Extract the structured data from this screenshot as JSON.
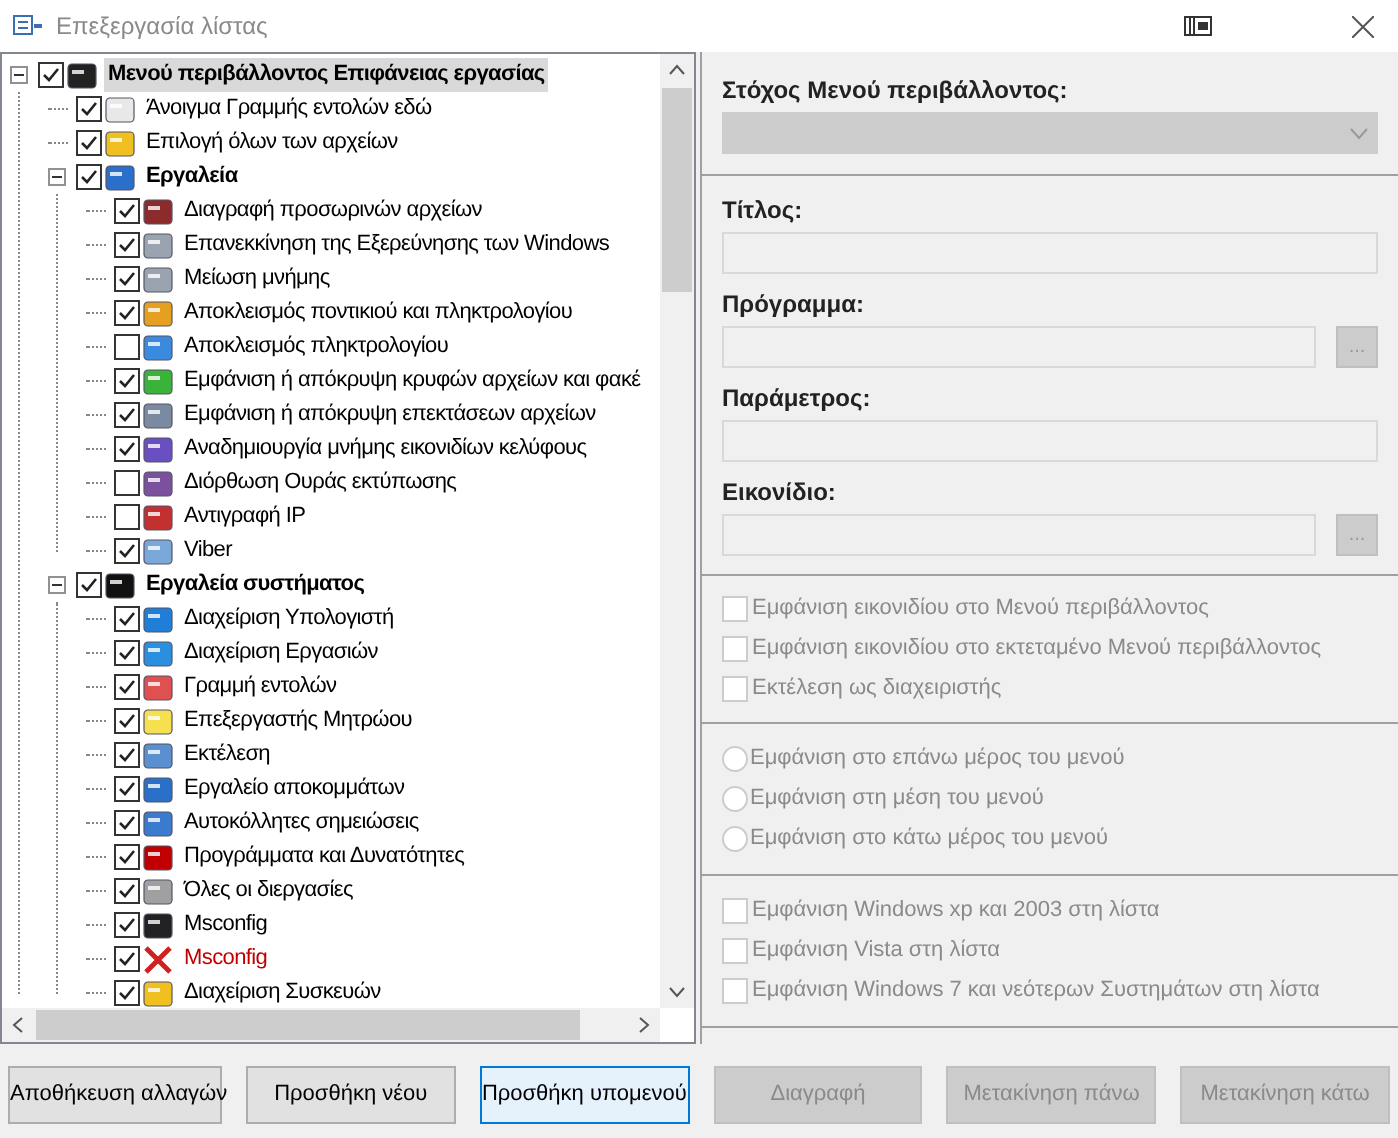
{
  "window": {
    "title": "Επεξεργασία λίστας"
  },
  "tree": [
    {
      "label": "Μενού περιβάλλοντος Επιφάνειας εργασίας",
      "checked": true,
      "expanded": true,
      "selected": true,
      "children": [
        {
          "label": "Άνοιγμα Γραμμής εντολών εδώ",
          "checked": true,
          "invalid": false
        },
        {
          "label": "Επιλογή όλων των αρχείων",
          "checked": true,
          "invalid": false
        },
        {
          "label": "Εργαλεία",
          "checked": true,
          "expanded": true,
          "selected": false,
          "children": [
            {
              "label": "Διαγραφή προσωρινών αρχείων",
              "checked": true,
              "invalid": false
            },
            {
              "label": "Επανεκκίνηση της Εξερεύνησης των Windows",
              "checked": true,
              "invalid": false
            },
            {
              "label": "Μείωση μνήμης",
              "checked": true,
              "invalid": false
            },
            {
              "label": "Αποκλεισμός ποντικιού και πληκτρολογίου",
              "checked": true,
              "invalid": false
            },
            {
              "label": "Αποκλεισμός πληκτρολογίου",
              "checked": false,
              "invalid": false
            },
            {
              "label": "Εμφάνιση ή απόκρυψη κρυφών αρχείων και φακέ",
              "checked": true,
              "invalid": false
            },
            {
              "label": "Εμφάνιση ή απόκρυψη επεκτάσεων αρχείων",
              "checked": true,
              "invalid": false
            },
            {
              "label": "Αναδημιουργία μνήμης εικονιδίων κελύφους",
              "checked": true,
              "invalid": false
            },
            {
              "label": "Διόρθωση Ουράς εκτύπωσης",
              "checked": false,
              "invalid": false
            },
            {
              "label": "Αντιγραφή IP",
              "checked": false,
              "invalid": false
            },
            {
              "label": "Viber",
              "checked": true,
              "invalid": false
            }
          ]
        },
        {
          "label": "Εργαλεία συστήματος",
          "checked": true,
          "expanded": true,
          "selected": false,
          "children": [
            {
              "label": "Διαχείριση Υπολογιστή",
              "checked": true,
              "invalid": false
            },
            {
              "label": "Διαχείριση Εργασιών",
              "checked": true,
              "invalid": false
            },
            {
              "label": "Γραμμή εντολών",
              "checked": true,
              "invalid": false
            },
            {
              "label": "Επεξεργαστής Μητρώου",
              "checked": true,
              "invalid": false
            },
            {
              "label": "Εκτέλεση",
              "checked": true,
              "invalid": false
            },
            {
              "label": "Εργαλείο αποκομμάτων",
              "checked": true,
              "invalid": false
            },
            {
              "label": "Αυτοκόλλητες σημειώσεις",
              "checked": true,
              "invalid": false
            },
            {
              "label": "Προγράμματα και Δυνατότητες",
              "checked": true,
              "invalid": false
            },
            {
              "label": "Όλες οι διεργασίες",
              "checked": true,
              "invalid": false
            },
            {
              "label": "Msconfig",
              "checked": true,
              "invalid": false
            },
            {
              "label": "Msconfig",
              "checked": true,
              "invalid": true
            },
            {
              "label": "Διαχείριση Συσκευών",
              "checked": true,
              "invalid": false
            }
          ]
        }
      ]
    }
  ],
  "target": {
    "label": "Στόχος Μενού περιβάλλοντος:",
    "disabled": true
  },
  "fields": [
    {
      "label": "Τίτλος:",
      "browse": false
    },
    {
      "label": "Πρόγραμμα:",
      "browse": true,
      "browse_label": "..."
    },
    {
      "label": "Παράμετρος:",
      "browse": false
    },
    {
      "label": "Εικονίδιο:",
      "browse": true,
      "browse_label": "..."
    }
  ],
  "options": [
    {
      "label": "Εμφάνιση εικονιδίου στο Μενού περιβάλλοντος",
      "checked": false
    },
    {
      "label": "Εμφάνιση εικονιδίου στο εκτεταμένο Μενού περιβάλλοντος",
      "checked": false
    },
    {
      "label": "Εκτέλεση ως διαχειριστής",
      "checked": false
    }
  ],
  "position": [
    {
      "label": "Εμφάνιση στο επάνω μέρος του μενού",
      "selected": false
    },
    {
      "label": "Εμφάνιση στη μέση του μενού",
      "selected": false
    },
    {
      "label": "Εμφάνιση στο κάτω μέρος του μενού",
      "selected": false
    }
  ],
  "systems": [
    {
      "label": "Εμφάνιση Windows xp και 2003 στη λίστα",
      "checked": false
    },
    {
      "label": "Εμφάνιση Vista στη λίστα",
      "checked": false
    },
    {
      "label": "Εμφάνιση Windows 7 και νεότερων Συστημάτων στη λίστα",
      "checked": false
    }
  ],
  "buttons": [
    {
      "label": "Αποθήκευση αλλαγών",
      "disabled": false,
      "focused": false
    },
    {
      "label": "Προσθήκη νέου",
      "disabled": false,
      "focused": false
    },
    {
      "label": "Προσθήκη υπομενού",
      "disabled": false,
      "focused": true
    },
    {
      "label": "Διαγραφή",
      "disabled": true,
      "focused": false
    },
    {
      "label": "Μετακίνηση πάνω",
      "disabled": true,
      "focused": false
    },
    {
      "label": "Μετακίνηση κάτω",
      "disabled": true,
      "focused": false
    }
  ]
}
